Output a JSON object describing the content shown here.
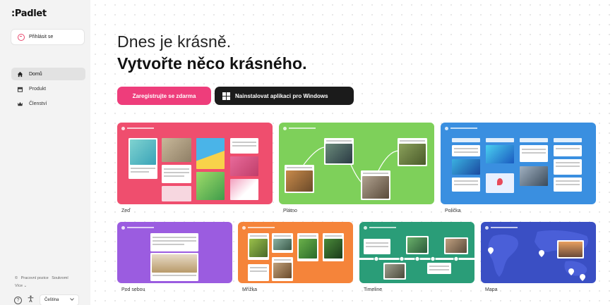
{
  "sidebar": {
    "logo": ":Padlet",
    "login_label": "Přihlásit se",
    "nav": [
      {
        "label": "Domů",
        "icon": "home-icon",
        "active": true
      },
      {
        "label": "Produkt",
        "icon": "product-icon",
        "active": false
      },
      {
        "label": "Členství",
        "icon": "crown-icon",
        "active": false
      }
    ],
    "footer": {
      "copyright": "©",
      "terms": "Pracovní pozice",
      "privacy": "Soukromí",
      "more": "Více ⌄"
    },
    "language": "Čeština"
  },
  "hero": {
    "line1": "Dnes je krásně.",
    "line2": "Vytvořte něco krásného.",
    "register_label": "Zaregistrujte se zdarma",
    "windows_label": "Nainstalovat aplikaci pro Windows"
  },
  "templates": [
    {
      "label": "Zeď",
      "color": "#ef4e6e"
    },
    {
      "label": "Plátno",
      "color": "#7ed05a"
    },
    {
      "label": "Polička",
      "color": "#3a8fe0"
    },
    {
      "label": "Pod sebou",
      "color": "#9b5ce0"
    },
    {
      "label": "Mřížka",
      "color": "#f5843a"
    },
    {
      "label": "Timeline",
      "color": "#2a9d78"
    },
    {
      "label": "Mapa",
      "color": "#3a4fc4"
    }
  ]
}
